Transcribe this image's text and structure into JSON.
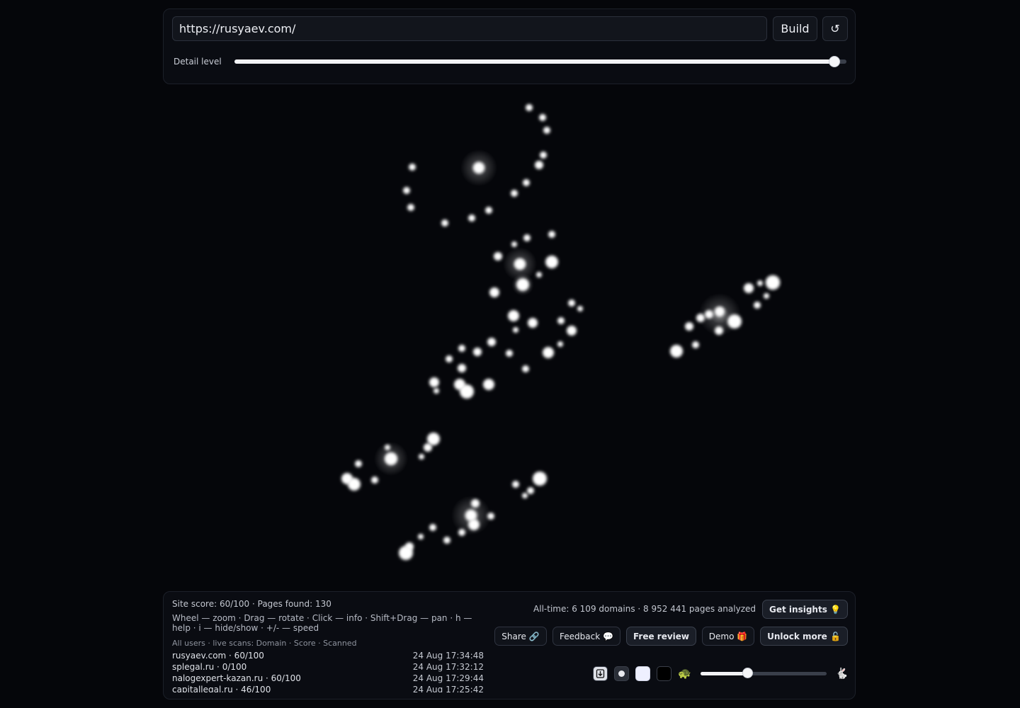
{
  "top": {
    "url_value": "https://rusyaev.com/",
    "build_label": "Build",
    "refresh_icon": "↺",
    "detail_label": "Detail level",
    "detail_value": 0.98
  },
  "info": {
    "score_line": "Site score: 60/100 · Pages found: 130",
    "hint": "Wheel — zoom · Drag — rotate · Click — info · Shift+Drag — pan · h — help · i — hide/show · +/- — speed",
    "scans_header": "All users · live scans: Domain · Score · Scanned",
    "scans": [
      {
        "domain": "rusyaev.com · 60/100",
        "time": "24 Aug 17:34:48"
      },
      {
        "domain": "splegal.ru · 0/100",
        "time": "24 Aug 17:32:12"
      },
      {
        "domain": "nalogexpert-kazan.ru · 60/100",
        "time": "24 Aug 17:29:44"
      },
      {
        "domain": "capitallegal.ru · 46/100",
        "time": "24 Aug 17:25:42"
      }
    ]
  },
  "stats": {
    "alltime": "All-time: 6 109 domains · 8 952 441 pages analyzed",
    "insights_label": "Get insights 💡",
    "share_label": "Share 🔗",
    "feedback_label": "Feedback 💬",
    "free_review_label": "Free review",
    "demo_label": "Demo 🎁",
    "unlock_label": "Unlock more 🔓"
  },
  "controls": {
    "download_icon": "download-icon",
    "slow_icon": "🐢",
    "fast_icon": "🐇",
    "speed_value": 0.37
  },
  "colors": {
    "background": "#05060a",
    "node": "#ffffff",
    "panel": "#0a0c12"
  }
}
